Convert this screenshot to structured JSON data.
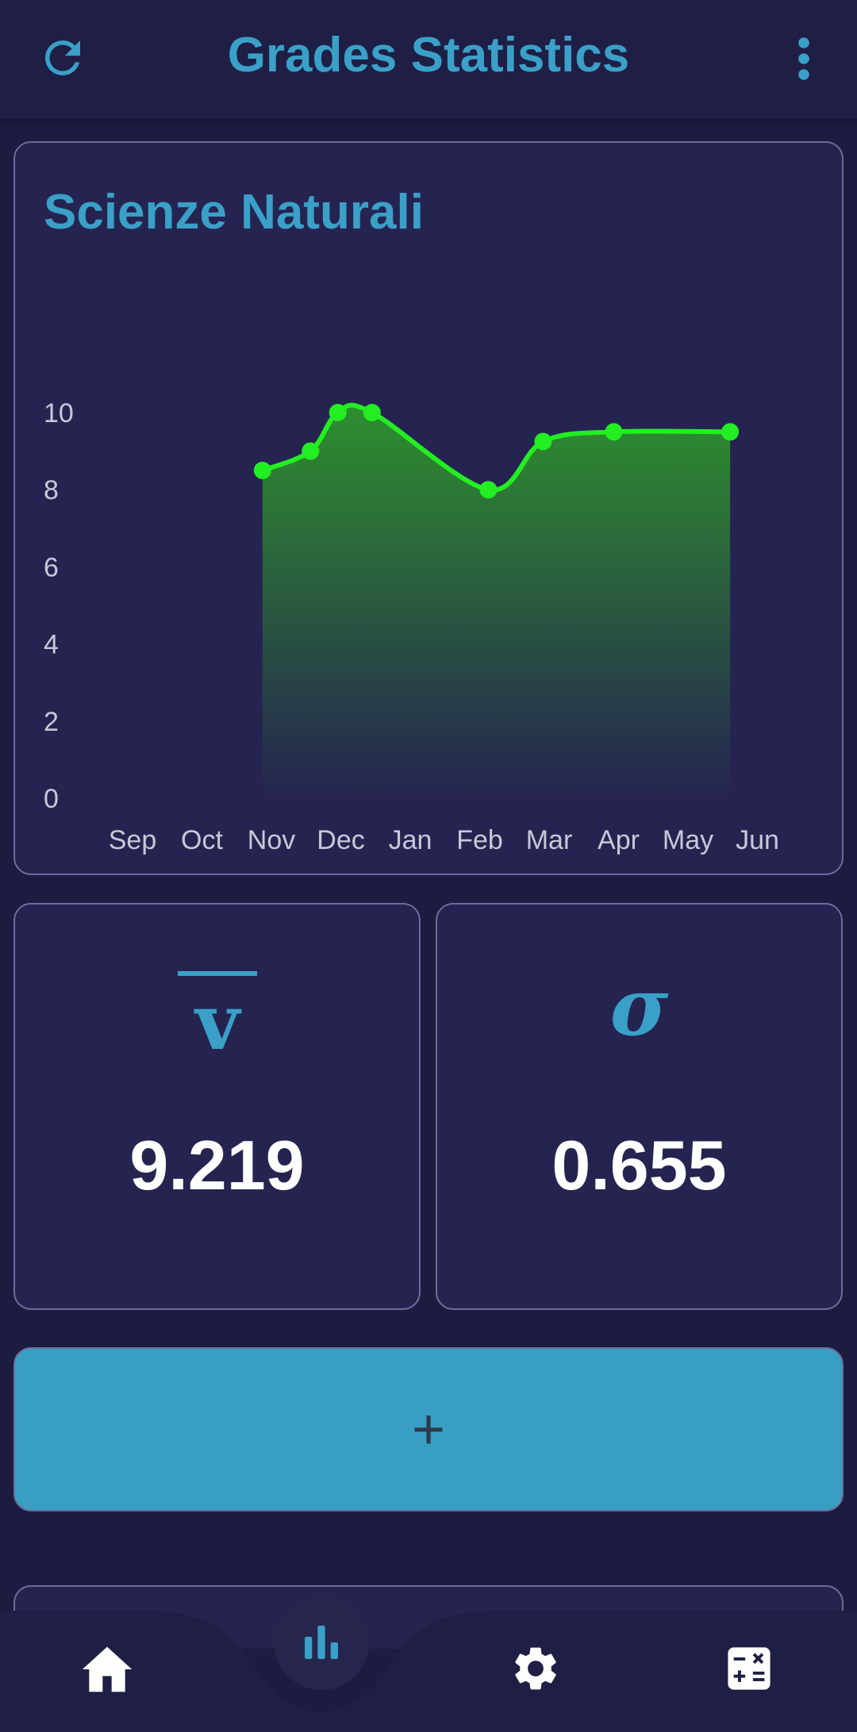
{
  "appbar": {
    "title": "Grades Statistics",
    "refresh_icon": "refresh-icon",
    "more_icon": "more-vert-icon"
  },
  "chart_card": {
    "title": "Scienze Naturali"
  },
  "chart_data": {
    "type": "area",
    "title": "Scienze Naturali",
    "xlabel": "",
    "ylabel": "",
    "x_ticks": [
      "Sep",
      "Oct",
      "Nov",
      "Dec",
      "Jan",
      "Feb",
      "Mar",
      "Apr",
      "May",
      "Jun"
    ],
    "y_ticks": [
      0,
      2,
      4,
      6,
      8,
      10
    ],
    "ylim": [
      0,
      10
    ],
    "grid": false,
    "series": [
      {
        "values": [
          {
            "x": "2023-10-28",
            "y": 8.5
          },
          {
            "x": "2023-11-18",
            "y": 9.0
          },
          {
            "x": "2023-11-30",
            "y": 10.0
          },
          {
            "x": "2023-12-15",
            "y": 10.0
          },
          {
            "x": "2024-02-04",
            "y": 8.0
          },
          {
            "x": "2024-02-28",
            "y": 9.25
          },
          {
            "x": "2024-03-30",
            "y": 9.5
          },
          {
            "x": "2024-05-20",
            "y": 9.5
          }
        ]
      }
    ],
    "colors": {
      "line": "#22ee22",
      "area_top": "#2e8f2e",
      "area_bottom": "#252450"
    }
  },
  "stats": {
    "mean": {
      "symbol": "v",
      "value": "9.219"
    },
    "std": {
      "symbol": "σ",
      "value": "0.655"
    }
  },
  "add_button": {
    "label": "+"
  },
  "bottom_nav": {
    "items": [
      {
        "icon": "home-icon"
      },
      {
        "icon": "bar-chart-icon",
        "active": true
      },
      {
        "icon": "settings-gear-icon"
      },
      {
        "icon": "calculator-icon"
      }
    ]
  },
  "colors": {
    "background": "#1c1b40",
    "card": "#252450",
    "accent": "#3aa0c8",
    "card_border": "#6e6c9e"
  }
}
